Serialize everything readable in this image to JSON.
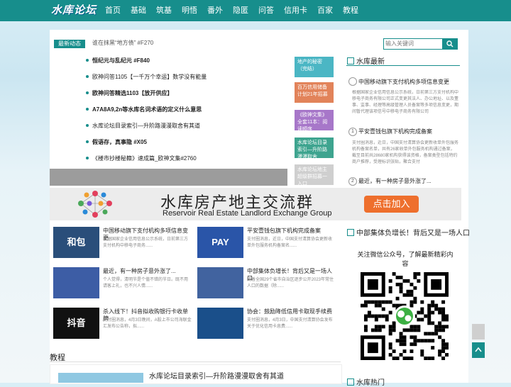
{
  "site": {
    "logo": "水库论坛"
  },
  "nav": [
    "首页",
    "基础",
    "筑基",
    "明悟",
    "番外",
    "隐匿",
    "问答",
    "信用卡",
    "百家",
    "教程"
  ],
  "ticker": {
    "badge": "最新动态",
    "text": "谁在抹黑“地方债” #F270"
  },
  "search": {
    "placeholder": "输入关键词"
  },
  "news": [
    {
      "title": "恒纪元与乱纪元 #F840",
      "bold": true
    },
    {
      "title": "欧神问答1105【一千万个幸运】数学没有能量",
      "bold": false
    },
    {
      "title": "欧神问答精选1103【放开供应】",
      "bold": true
    },
    {
      "title": "A7A8A9,2n等水库名词术语的定义什么意思",
      "bold": true
    },
    {
      "title": "水库论坛目录索引—升阶路漫漫取舍有其道",
      "bold": false
    },
    {
      "title": "假语存，真事隐 #X05",
      "bold": true
    },
    {
      "title": "《楼市抄楼秘籍》速成篇_欧神文集#2760",
      "bold": false
    }
  ],
  "cards": [
    {
      "text": "地产的秘密（完结）",
      "color": "#4bb6c4"
    },
    {
      "text": "百万信用储备计划21年招募",
      "color": "#e2835a"
    },
    {
      "text": "《欧神文集》全套11本：阅读顺序",
      "color": "#a777c9"
    },
    {
      "text": "水库论坛目录索引—升阶路漫漫取舍",
      "color": "#3ea48f"
    },
    {
      "text": "水库论坛地主超级群招募一入口",
      "color": "#cfcfcf"
    }
  ],
  "latest": {
    "title": "水库最新",
    "items": [
      {
        "num": "",
        "title": "中国移动旗下支付机构多项信息变更",
        "desc": "根据国家企业信用信息公示系统，日前第三方支付机构中移电子商务有限公司正式变更其法人、办公地址、以及董事、监事、经理等高级管理人员备案等多项信息变更，期间暂代理该项信号中移电子商务有限公司"
      },
      {
        "num": "1",
        "title": "平安壹钱包旗下机构完成备案",
        "desc": "支付圈消息，近日，中国支付清算协会更新收单外包服务机构备案名单，共有26家收单外包服务机构通过备案，截至目前共28680家机构获得该资格，备案类型包括特约商户推荐，受理标识张贴，聚合支付"
      },
      {
        "num": "2",
        "title": "最近，有一种房子意外涨了..."
      }
    ]
  },
  "banner": {
    "title": "水库房产地主交流群",
    "subtitle": "Reservoir Real Estate Landlord Exchange Group",
    "cta": "点击加入"
  },
  "articles": [
    {
      "title": "中国移动旗下支付机构多项信息变更",
      "desc": "根据国家企业信用信息公示系统，日前第三方支付机构中移电子商务......",
      "thumb": "#2a4e7a",
      "thumb_text": "和包"
    },
    {
      "title": "平安壹钱包旗下机构完成备案",
      "desc": "支付圈消息，近日，中国支付清算协会更新收单外包服务机构备案名......",
      "thumb": "#2a55a8",
      "thumb_text": "PAY"
    },
    {
      "title": "最近，有一种房子意外涨了...",
      "desc": "个人觉得，清明节是个值不错的节日。既不用请客上礼，也不兴人情......",
      "thumb": "#3d5da5",
      "thumb_text": ""
    },
    {
      "title": "中部集体负增长！背后又是一场人口",
      "desc": "随着全国29个省市自治区逐步公开2023年常住人口的数据（除......",
      "thumb": "#41639f",
      "thumb_text": ""
    },
    {
      "title": "杀入线下！抖音拟收购银行卡收单牌",
      "desc": "支付圈消息，4月3日晚间，A股上市公司海联金汇发布公告称，拟......",
      "thumb": "#111111",
      "thumb_text": "抖音"
    },
    {
      "title": "协会：鼓励降低信用卡取现手续费",
      "desc": "支付圈消息，4月3日，中国支付清算协会发布关于优化信用卡息费......",
      "thumb": "#1a4f8a",
      "thumb_text": ""
    }
  ],
  "education": {
    "title": "教程",
    "item": "水库论坛目录索引—升阶路漫漫取舍有其道"
  },
  "popup": {
    "text": "关注微信公众号，了解最新精彩内容",
    "bg_title": "中部集体负增长！背后又是一场人口"
  },
  "hot": {
    "title": "水库热门"
  }
}
